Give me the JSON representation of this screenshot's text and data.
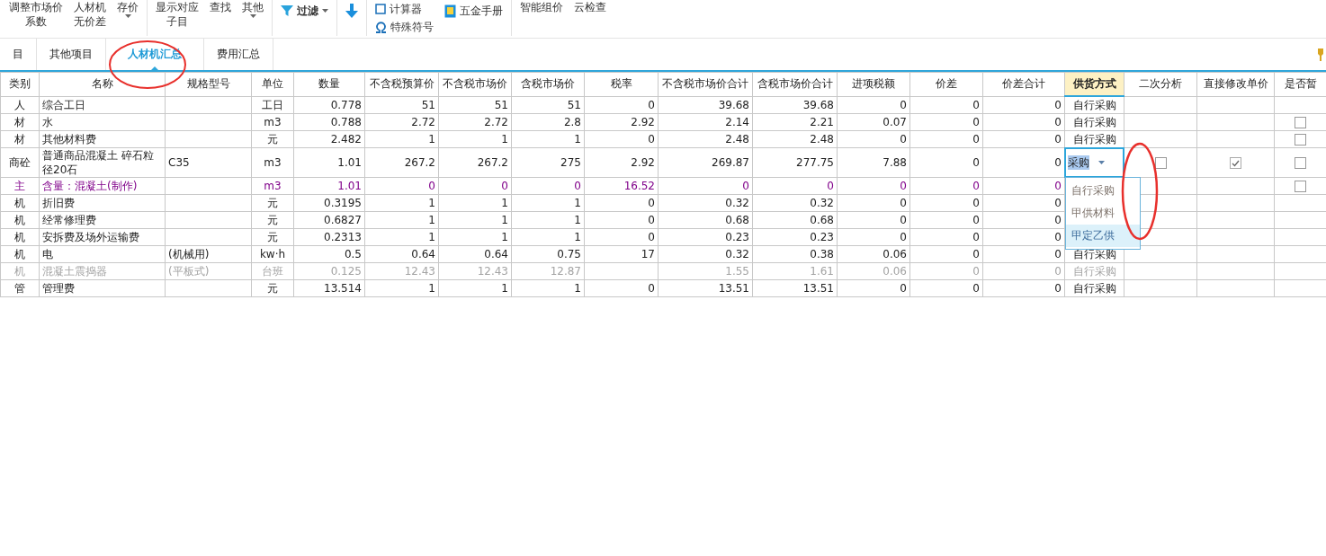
{
  "toolbar": [
    {
      "kind": "text",
      "lines": [
        "调整市场价",
        "系数"
      ]
    },
    {
      "kind": "text",
      "lines": [
        "人材机",
        "无价差"
      ]
    },
    {
      "kind": "menu",
      "lines": [
        "存价"
      ]
    },
    {
      "kind": "separator"
    },
    {
      "kind": "text",
      "lines": [
        "显示对应",
        "子目"
      ]
    },
    {
      "kind": "text",
      "lines": [
        "查找"
      ]
    },
    {
      "kind": "menu",
      "lines": [
        "其他"
      ]
    },
    {
      "kind": "separator"
    },
    {
      "kind": "filter",
      "lines": [
        "过滤"
      ]
    },
    {
      "kind": "separator"
    },
    {
      "kind": "arrow"
    },
    {
      "kind": "separator"
    },
    {
      "kind": "stack",
      "items": [
        {
          "kind": "calculator",
          "label": "计算器"
        },
        {
          "kind": "symbols",
          "label": "特殊符号"
        }
      ]
    },
    {
      "kind": "book",
      "lines": [
        "五金手册"
      ]
    },
    {
      "kind": "separator"
    },
    {
      "kind": "text",
      "lines": [
        "智能组价"
      ]
    },
    {
      "kind": "text",
      "lines": [
        "云检查"
      ]
    }
  ],
  "tabs": [
    {
      "label": "目",
      "selected": false
    },
    {
      "label": "其他项目",
      "selected": false
    },
    {
      "label": "人材机汇总",
      "selected": true
    },
    {
      "label": "费用汇总",
      "selected": false
    }
  ],
  "table": {
    "columns": [
      {
        "label": "类别",
        "highlighted": false
      },
      {
        "label": "名称",
        "highlighted": false
      },
      {
        "label": "规格型号",
        "highlighted": false
      },
      {
        "label": "单位",
        "highlighted": false
      },
      {
        "label": "数量",
        "highlighted": false
      },
      {
        "label": "不含税预算价",
        "highlighted": false
      },
      {
        "label": "不含税市场价",
        "highlighted": false
      },
      {
        "label": "含税市场价",
        "highlighted": false
      },
      {
        "label": "税率",
        "highlighted": false
      },
      {
        "label": "不含税市场价合计",
        "highlighted": false
      },
      {
        "label": "含税市场价合计",
        "highlighted": false
      },
      {
        "label": "进项税额",
        "highlighted": false
      },
      {
        "label": "价差",
        "highlighted": false
      },
      {
        "label": "价差合计",
        "highlighted": false
      },
      {
        "label": "供货方式",
        "highlighted": true
      },
      {
        "label": "二次分析",
        "highlighted": false
      },
      {
        "label": "直接修改单价",
        "highlighted": false
      },
      {
        "label": "是否暂",
        "highlighted": false
      }
    ],
    "rows": [
      {
        "kind": "normal",
        "category": "人",
        "name": "综合工日",
        "unit": "工日",
        "qty": "0.778",
        "budget": "51",
        "market": "51",
        "market_tax": "51",
        "tax_rate": "0",
        "total": "39.68",
        "total_tax": "39.68",
        "input_tax": "0",
        "diff": "0",
        "diff_total": "0",
        "supply": "自行采购"
      },
      {
        "kind": "normal",
        "category": "材",
        "name": "水",
        "unit": "m3",
        "qty": "0.788",
        "budget": "2.72",
        "market": "2.72",
        "market_tax": "2.8",
        "tax_rate": "2.92",
        "total": "2.14",
        "total_tax": "2.21",
        "input_tax": "0.07",
        "diff": "0",
        "diff_total": "0",
        "supply": "自行采购",
        "provisional": {
          "checked": false
        }
      },
      {
        "kind": "normal",
        "category": "材",
        "name": "其他材料费",
        "unit": "元",
        "qty": "2.482",
        "budget": "1",
        "market": "1",
        "market_tax": "1",
        "tax_rate": "0",
        "total": "2.48",
        "total_tax": "2.48",
        "input_tax": "0",
        "diff": "0",
        "diff_total": "0",
        "supply": "自行采购",
        "provisional": {
          "checked": false
        }
      },
      {
        "kind": "normal",
        "category": "商砼",
        "name": "普通商品混凝土 碎石粒径20石",
        "spec": "C35",
        "unit": "m3",
        "qty": "1.01",
        "budget": "267.2",
        "market": "267.2",
        "market_tax": "275",
        "tax_rate": "2.92",
        "total": "269.87",
        "total_tax": "277.75",
        "input_tax": "7.88",
        "diff": "0",
        "diff_total": "0",
        "supply_editor": {
          "value": "采购",
          "options": [
            {
              "label": "自行采购",
              "selected": false
            },
            {
              "label": "甲供材料",
              "selected": false
            },
            {
              "label": "甲定乙供",
              "selected": true
            }
          ]
        },
        "analysis": {
          "checked": false
        },
        "edit_price": {
          "checked": true
        },
        "provisional": {
          "checked": false
        }
      },
      {
        "kind": "main",
        "category": "主",
        "name": "含量：混凝土(制作)",
        "unit": "m3",
        "qty": "1.01",
        "budget": "0",
        "market": "0",
        "market_tax": "0",
        "tax_rate": "16.52",
        "total": "0",
        "total_tax": "0",
        "input_tax": "0",
        "diff": "0",
        "diff_total": "0",
        "provisional": {
          "checked": false
        }
      },
      {
        "kind": "normal",
        "category": "机",
        "name": "折旧费",
        "unit": "元",
        "qty": "0.3195",
        "budget": "1",
        "market": "1",
        "market_tax": "1",
        "tax_rate": "0",
        "total": "0.32",
        "total_tax": "0.32",
        "input_tax": "0",
        "diff": "0",
        "diff_total": "0"
      },
      {
        "kind": "normal",
        "category": "机",
        "name": "经常修理费",
        "unit": "元",
        "qty": "0.6827",
        "budget": "1",
        "market": "1",
        "market_tax": "1",
        "tax_rate": "0",
        "total": "0.68",
        "total_tax": "0.68",
        "input_tax": "0",
        "diff": "0",
        "diff_total": "0"
      },
      {
        "kind": "normal",
        "category": "机",
        "name": "安拆费及场外运输费",
        "unit": "元",
        "qty": "0.2313",
        "budget": "1",
        "market": "1",
        "market_tax": "1",
        "tax_rate": "0",
        "total": "0.23",
        "total_tax": "0.23",
        "input_tax": "0",
        "diff": "0",
        "diff_total": "0"
      },
      {
        "kind": "normal",
        "category": "机",
        "name": "电",
        "spec": "(机械用)",
        "unit": "kw·h",
        "qty": "0.5",
        "budget": "0.64",
        "market": "0.64",
        "market_tax": "0.75",
        "tax_rate": "17",
        "total": "0.32",
        "total_tax": "0.38",
        "input_tax": "0.06",
        "diff": "0",
        "diff_total": "0",
        "supply": "自行采购"
      },
      {
        "kind": "disabled",
        "category": "机",
        "name": "混凝土震捣器",
        "spec": "(平板式)",
        "unit": "台班",
        "qty": "0.125",
        "budget": "12.43",
        "market": "12.43",
        "market_tax": "12.87",
        "total": "1.55",
        "total_tax": "1.61",
        "input_tax": "0.06",
        "diff": "0",
        "diff_total": "0",
        "supply": "自行采购"
      },
      {
        "kind": "normal",
        "category": "管",
        "name": "管理费",
        "unit": "元",
        "qty": "13.514",
        "budget": "1",
        "market": "1",
        "market_tax": "1",
        "tax_rate": "0",
        "total": "13.51",
        "total_tax": "13.51",
        "input_tax": "0",
        "diff": "0",
        "diff_total": "0",
        "supply": "自行采购"
      }
    ]
  }
}
